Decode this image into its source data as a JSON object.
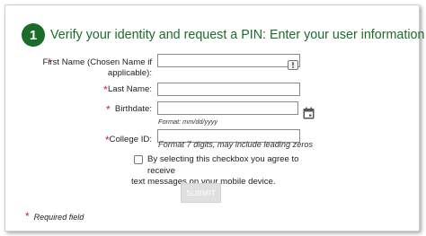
{
  "step": {
    "number": "1",
    "title": "Verify your identity and request a PIN: Enter your user information"
  },
  "form": {
    "required_marker": "*",
    "first_name": {
      "label_line1": "First Name (Chosen Name if",
      "label_line2": "applicable):",
      "value": ""
    },
    "last_name": {
      "label": "Last Name:",
      "value": ""
    },
    "birthdate": {
      "label": "Birthdate:",
      "value": "",
      "hint": "Format: mm/dd/yyyy"
    },
    "college_id": {
      "label": "College ID:",
      "value": "",
      "hint": "Format 7 digits, may include leading zeros"
    },
    "consent": {
      "checked": false,
      "text_line1": "By selecting this checkbox you agree to receive",
      "text_line2": "text messages on your mobile device."
    },
    "submit_label": "SUBMIT",
    "required_note": "Required field"
  },
  "colors": {
    "brand_green": "#1d6b2a",
    "required_red": "#c0272d",
    "disabled_button": "#e0e0e0"
  }
}
